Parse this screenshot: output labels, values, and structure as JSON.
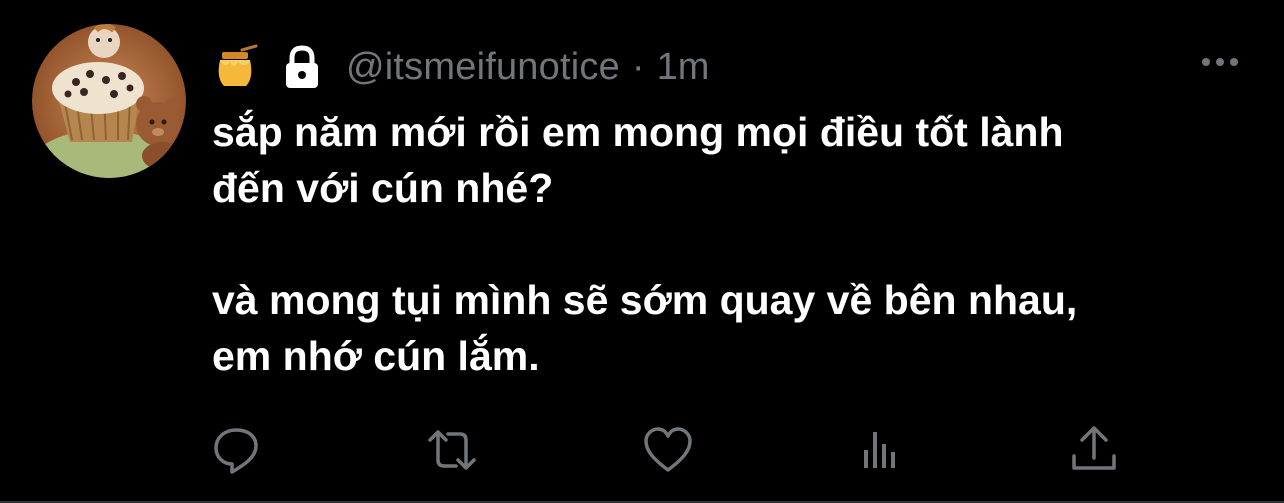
{
  "tweet": {
    "handle": "@itsmeifunotice",
    "separator": "·",
    "time": "1m",
    "lines": [
      "sắp năm mới rồi em mong mọi điều tốt lành",
      "đến với cún nhé?",
      "và mong tụi mình sẽ sớm quay về bên nhau,",
      "em nhớ cún lắm."
    ]
  },
  "icons": {
    "badge": "honey-pot-icon",
    "protected": "lock-icon",
    "more": "more-icon",
    "reply": "reply-icon",
    "retweet": "retweet-icon",
    "like": "like-icon",
    "views": "views-icon",
    "share": "share-icon"
  },
  "colors": {
    "background": "#000000",
    "text": "#ffffff",
    "muted": "#71767b",
    "honey": "#f5a623"
  }
}
